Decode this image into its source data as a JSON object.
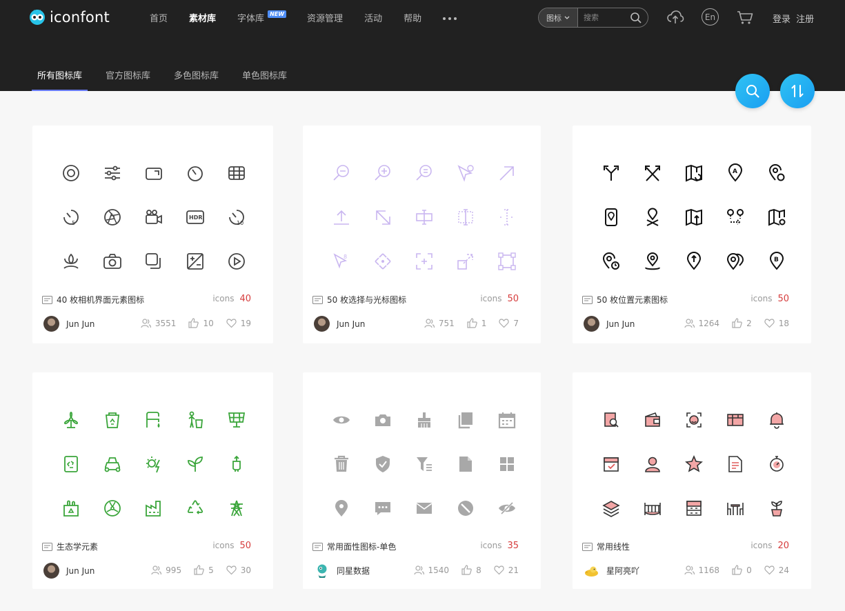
{
  "brand": {
    "name": "iconfont"
  },
  "nav": {
    "items": [
      "首页",
      "素材库",
      "字体库",
      "资源管理",
      "活动",
      "帮助"
    ],
    "active_index": 1,
    "new_badge": "NEW"
  },
  "search": {
    "scope": "图标",
    "placeholder": "搜索"
  },
  "lang_button": "En",
  "auth": {
    "login": "登录",
    "register": "注册"
  },
  "subtabs": {
    "items": [
      "所有图标库",
      "官方图标库",
      "多色图标库",
      "单色图标库"
    ],
    "active_index": 0
  },
  "colors": {
    "accent": "#6b7df6",
    "count": "#d63c3c",
    "green": "#3aa53a",
    "lavender": "#c9b6f0",
    "gray": "#a8a8a8",
    "red": "#e05a5a"
  },
  "cards": [
    {
      "title": "40 枚相机界面元素图标",
      "count_label": "icons",
      "count": "40",
      "author": "Jun Jun",
      "views": "3551",
      "likes": "10",
      "favs": "19",
      "style": "outline-dark"
    },
    {
      "title": "50 枚选择与光标图标",
      "count_label": "icons",
      "count": "50",
      "author": "Jun Jun",
      "views": "751",
      "likes": "1",
      "favs": "7",
      "style": "lavender"
    },
    {
      "title": "50 枚位置元素图标",
      "count_label": "icons",
      "count": "50",
      "author": "Jun Jun",
      "views": "1264",
      "likes": "2",
      "favs": "18",
      "style": "black"
    },
    {
      "title": "生态学元素",
      "count_label": "icons",
      "count": "50",
      "author": "Jun Jun",
      "views": "995",
      "likes": "5",
      "favs": "30",
      "style": "green"
    },
    {
      "title": "常用面性图标-单色",
      "count_label": "icons",
      "count": "35",
      "author": "同星数据",
      "views": "1540",
      "likes": "8",
      "favs": "21",
      "style": "gray-fill"
    },
    {
      "title": "常用线性",
      "count_label": "icons",
      "count": "20",
      "author": "星阿亮吖",
      "views": "1168",
      "likes": "0",
      "favs": "24",
      "style": "red-line"
    }
  ]
}
